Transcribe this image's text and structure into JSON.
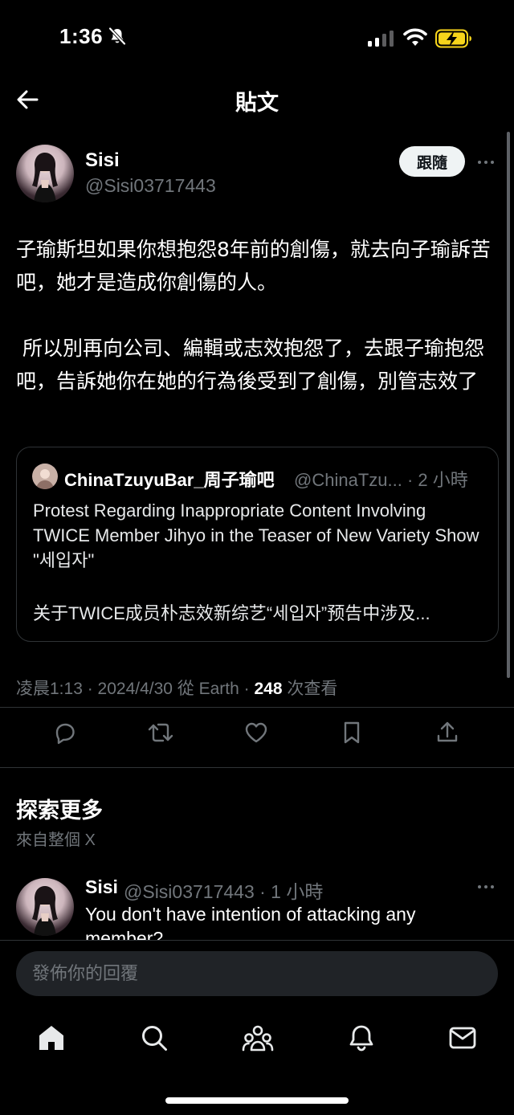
{
  "status_bar": {
    "time": "1:36",
    "icons": [
      "bell-slash-icon",
      "signal-icon",
      "wifi-icon",
      "battery-charging-icon"
    ]
  },
  "header": {
    "title": "貼文",
    "back_icon": "arrow-left-icon"
  },
  "post": {
    "author_name": "Sisi",
    "author_handle": "@Sisi03717443",
    "follow_label": "跟隨",
    "text": "子瑜斯坦如果你想抱怨8年前的創傷，就去向子瑜訴苦吧，她才是造成你創傷的人。\n\n 所以別再向公司、編輯或志效抱怨了，去跟子瑜抱怨吧，告訴她你在她的行為後受到了創傷，別管志效了",
    "meta_time": "凌晨1:13 · 2024/4/30 從 Earth · ",
    "views_count": "248",
    "views_label": " 次查看"
  },
  "quote": {
    "author_name": "ChinaTzuyuBar_周子瑜吧",
    "meta": "@ChinaTzu... · 2 小時",
    "text": "Protest Regarding Inappropriate Content Involving TWICE Member Jihyo in the Teaser of New Variety Show \"세입자\"",
    "text2": "关于TWICE成员朴志效新综艺“세입자”预告中涉及..."
  },
  "actions": [
    "reply-icon",
    "retweet-icon",
    "heart-icon",
    "bookmark-icon",
    "share-icon"
  ],
  "explore": {
    "title": "探索更多",
    "subtitle": "來自整個 X",
    "item": {
      "author_name": "Sisi",
      "meta": "@Sisi03717443 · 1 小時",
      "text": "You don't have intention of attacking any member?"
    }
  },
  "reply": {
    "placeholder": "發佈你的回覆"
  },
  "bottom_nav": [
    "home-icon",
    "search-icon",
    "communities-icon",
    "notifications-icon",
    "messages-icon"
  ],
  "colors": {
    "background": "#000000",
    "text": "#e7e9ea",
    "secondary": "#71767b",
    "border": "#2f3336",
    "battery": "#f7d51b"
  }
}
